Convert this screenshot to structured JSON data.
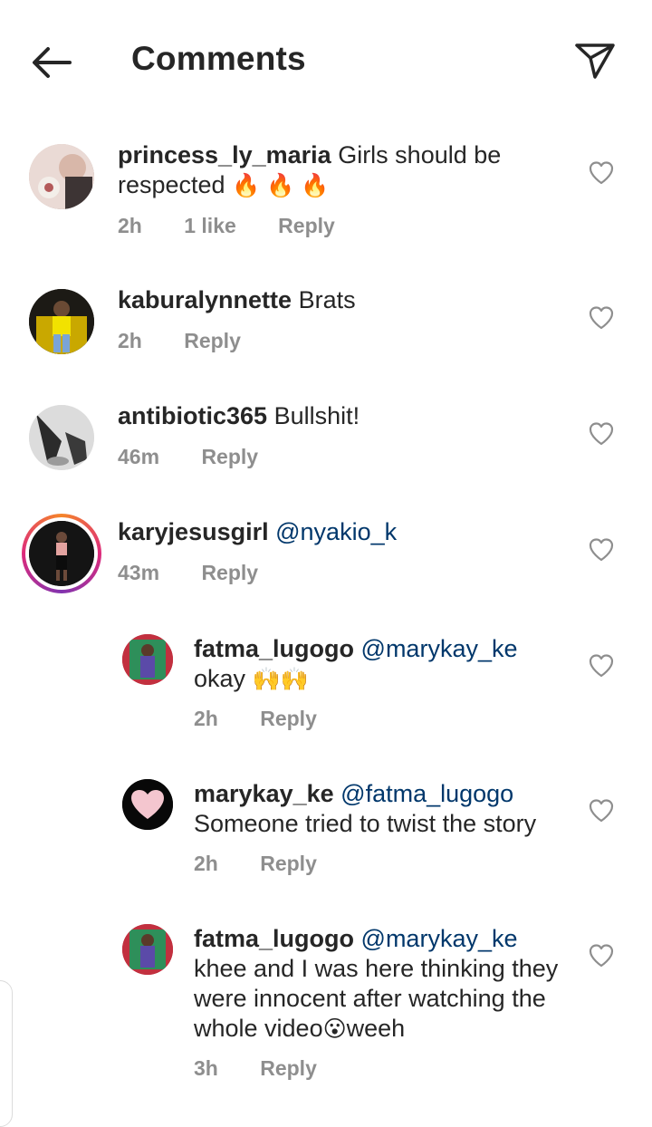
{
  "header": {
    "title": "Comments",
    "back_icon": "arrow-left-icon",
    "share_icon": "paper-plane-icon"
  },
  "comments": [
    {
      "username": "princess_ly_maria",
      "text": "Girls should be respected ",
      "emoji": "🔥 🔥 🔥",
      "time": "2h",
      "likes": "1 like",
      "reply": "Reply"
    },
    {
      "username": "kaburalynnette",
      "text": "Brats",
      "time": "2h",
      "reply": "Reply"
    },
    {
      "username": "antibiotic365",
      "text": "Bullshit!",
      "time": "46m",
      "reply": "Reply"
    },
    {
      "username": "karyjesusgirl",
      "mention": "@nyakio_k",
      "text": "",
      "time": "43m",
      "reply": "Reply"
    },
    {
      "username": "fatma_lugogo",
      "mention": "@marykay_ke",
      "text": "okay ",
      "emoji": "🙌🙌",
      "time": "2h",
      "reply": "Reply"
    },
    {
      "username": "marykay_ke",
      "mention": "@fatma_lugogo",
      "text": "Someone tried to twist the story",
      "time": "2h",
      "reply": "Reply"
    },
    {
      "username": "fatma_lugogo",
      "mention": "@marykay_ke",
      "text": "khee and I was here thinking they were innocent after watching the whole video",
      "emoji": "😮",
      "text_after": "weeh",
      "time": "3h",
      "reply": "Reply"
    }
  ],
  "colors": {
    "text": "#262626",
    "secondary": "#8e8e8e",
    "mention": "#00376b",
    "story_ring": "#dd2a7b"
  }
}
